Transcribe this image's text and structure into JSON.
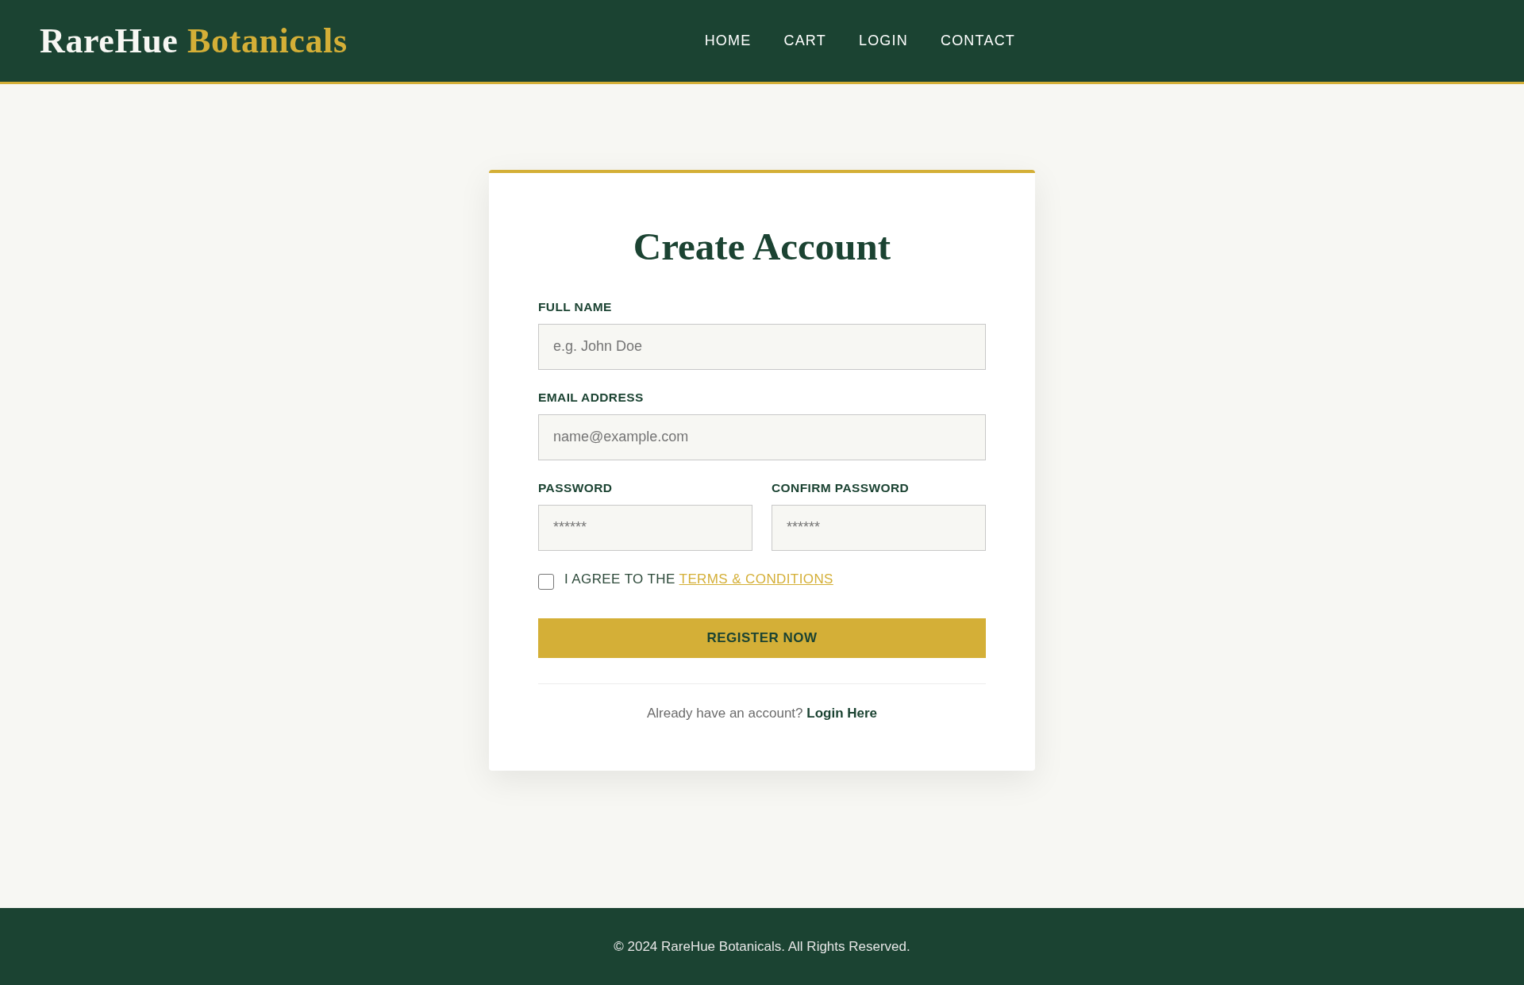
{
  "header": {
    "logo": {
      "primary": "RareHue",
      "accent": "Botanicals"
    },
    "nav": [
      "HOME",
      "CART",
      "LOGIN",
      "CONTACT"
    ]
  },
  "form": {
    "title": "Create Account",
    "field_rows": [
      [
        {
          "label": "FULL NAME",
          "placeholder": "e.g. John Doe"
        }
      ],
      [
        {
          "label": "EMAIL ADDRESS",
          "placeholder": "name@example.com"
        }
      ],
      [
        {
          "label": "PASSWORD",
          "placeholder": "******"
        },
        {
          "label": "CONFIRM PASSWORD",
          "placeholder": "******"
        }
      ]
    ],
    "agreement": {
      "checked": false,
      "text": "I AGREE TO THE",
      "link": "TERMS & CONDITIONS"
    },
    "submit": "REGISTER NOW",
    "login_prompt": {
      "text": "Already have an account?",
      "link": "Login Here"
    }
  },
  "footer": {
    "copyright": "© 2024 RareHue Botanicals. All Rights Reserved."
  }
}
